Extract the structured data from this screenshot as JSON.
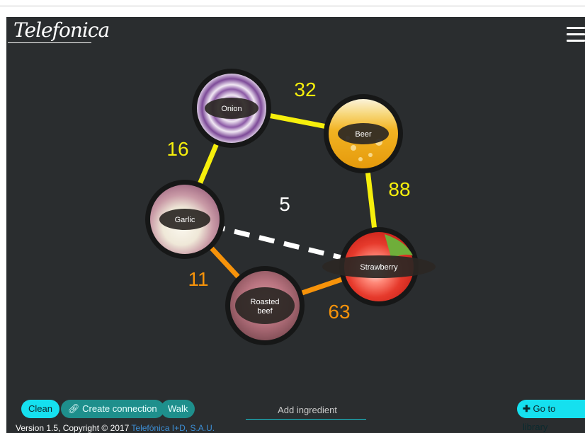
{
  "brand": {
    "logo": "Telefonica"
  },
  "graph": {
    "nodes": [
      {
        "id": "onion",
        "label": "Onion"
      },
      {
        "id": "beer",
        "label": "Beer"
      },
      {
        "id": "garlic",
        "label": "Garlic"
      },
      {
        "id": "strawberry",
        "label": "Strawberry"
      },
      {
        "id": "roasted-beef",
        "label": "Roasted beef"
      }
    ],
    "edges": [
      {
        "from": "onion",
        "to": "beer",
        "weight": "32",
        "style": "solid",
        "color": "#f6ef0c"
      },
      {
        "from": "onion",
        "to": "garlic",
        "weight": "16",
        "style": "solid",
        "color": "#f6ef0c"
      },
      {
        "from": "beer",
        "to": "strawberry",
        "weight": "88",
        "style": "solid",
        "color": "#f6ef0c"
      },
      {
        "from": "garlic",
        "to": "strawberry",
        "weight": "5",
        "style": "dashed",
        "color": "#ffffff"
      },
      {
        "from": "garlic",
        "to": "roasted-beef",
        "weight": "11",
        "style": "solid",
        "color": "#f7930a"
      },
      {
        "from": "roasted-beef",
        "to": "strawberry",
        "weight": "63",
        "style": "solid",
        "color": "#f7930a"
      }
    ]
  },
  "toolbar": {
    "clean": "Clean",
    "create_connection": "Create connection",
    "walk": "Walk",
    "add_ingredient_placeholder": "Add ingredient",
    "go_to_library": "Go to library"
  },
  "footer": {
    "version_text": "Version 1.5, Copyright © 2017",
    "company": "Telefónica I+D, S.A.U."
  },
  "colors": {
    "background": "#2a2d2f",
    "accent": "#15e0ef",
    "yellow_edge": "#f6ef0c",
    "orange_edge": "#f7930a"
  }
}
